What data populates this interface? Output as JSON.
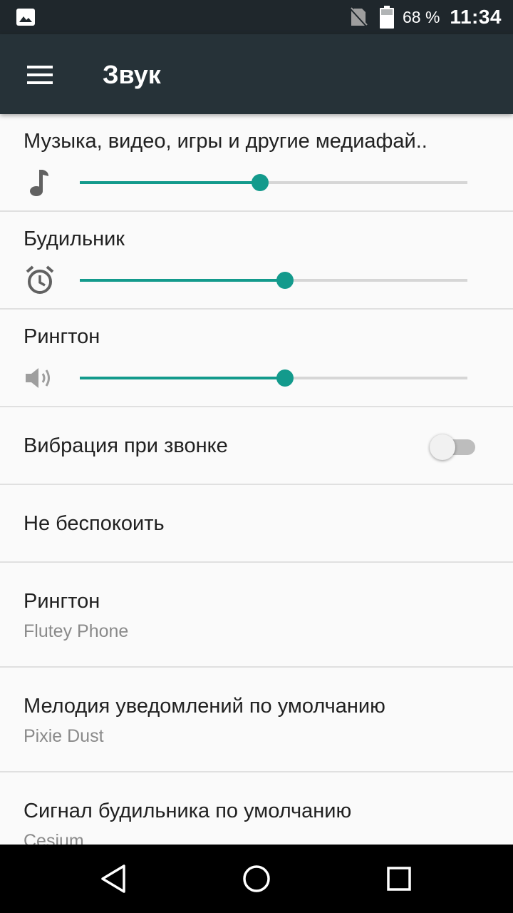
{
  "status_bar": {
    "battery_percent": "68 %",
    "time": "11:34"
  },
  "app_bar": {
    "title": "Звук"
  },
  "volume": {
    "media": {
      "label": "Музыка, видео, игры и другие медиафай..",
      "level": 0.465,
      "icon": "music-note-icon"
    },
    "alarm": {
      "label": "Будильник",
      "level": 0.53,
      "icon": "alarm-clock-icon"
    },
    "ringtone": {
      "label": "Рингтон",
      "level": 0.53,
      "icon": "speaker-icon"
    }
  },
  "settings": {
    "vibrate_on_ring": {
      "label": "Вибрация при звонке",
      "enabled": false
    },
    "do_not_disturb": {
      "label": "Не беспокоить"
    },
    "phone_ringtone": {
      "label": "Рингтон",
      "value": "Flutey Phone"
    },
    "notification_sound": {
      "label": "Мелодия уведомлений по умолчанию",
      "value": "Pixie Dust"
    },
    "alarm_sound": {
      "label": "Сигнал будильника по умолчанию",
      "value": "Cesium"
    }
  },
  "colors": {
    "accent": "#139a8c",
    "app_bar": "#263238",
    "status_bar": "#1f272c"
  }
}
